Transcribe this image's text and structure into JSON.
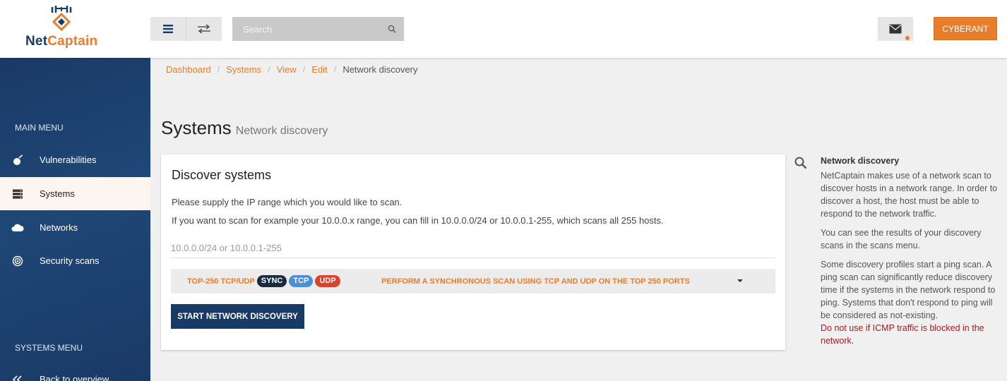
{
  "brand": {
    "name_part1": "Net",
    "name_part2": "Captain",
    "accent": "#e87d2c",
    "primary": "#1a3a66"
  },
  "header": {
    "menu_icon": "hamburger-icon",
    "swap_icon": "swap-arrows-icon",
    "search": {
      "placeholder": "Search",
      "icon": "search-icon"
    },
    "mail_icon": "envelope-icon",
    "user_label": "CYBERANT"
  },
  "sidebar": {
    "main_heading": "MAIN MENU",
    "items": [
      {
        "label": "Vulnerabilities",
        "icon": "bomb-icon"
      },
      {
        "label": "Systems",
        "icon": "server-icon",
        "active": true
      },
      {
        "label": "Networks",
        "icon": "cloud-icon"
      },
      {
        "label": "Security scans",
        "icon": "target-icon"
      }
    ],
    "systems_heading": "SYSTEMS MENU",
    "systems_items": [
      {
        "label": "Back to overview",
        "icon": "double-chevron-left-icon"
      }
    ]
  },
  "breadcrumb": [
    "Dashboard",
    "Systems",
    "View",
    "Edit",
    "Network discovery"
  ],
  "page": {
    "title": "Systems",
    "subtitle": "Network discovery"
  },
  "card": {
    "title": "Discover systems",
    "line1": "Please supply the IP range which you would like to scan.",
    "line2": "If you want to scan for example your 10.0.0.x range, you can fill in 10.0.0.0/24 or 10.0.0.1-255, which scans all 255 hosts.",
    "ip_placeholder": "10.0.0.0/24 or 10.0.0.1-255",
    "profile": {
      "name": "TOP-250 TCP/UDP",
      "badges": [
        {
          "label": "SYNC",
          "color": "#1a2a40"
        },
        {
          "label": "TCP",
          "color": "#4a90d9"
        },
        {
          "label": "UDP",
          "color": "#d9432e"
        }
      ],
      "description": "PERFORM A SYNCHRONOUS SCAN USING TCP AND UDP ON THE TOP 250 PORTS"
    },
    "start_label": "START NETWORK DISCOVERY"
  },
  "help": {
    "title": "Network discovery",
    "p1": "NetCaptain makes use of a network scan to discover hosts in a network range. In order to discover a host, the host must be able to respond to the network traffic.",
    "p2": "You can see the results of your discovery scans in the scans menu.",
    "p3": "Some discovery profiles start a ping scan. A ping scan can significantly reduce discovery time if the systems in the network respond to ping. Systems that don't respond to ping will be considered as not-existing.",
    "warning": "Do not use if ICMP traffic is blocked in the network."
  }
}
